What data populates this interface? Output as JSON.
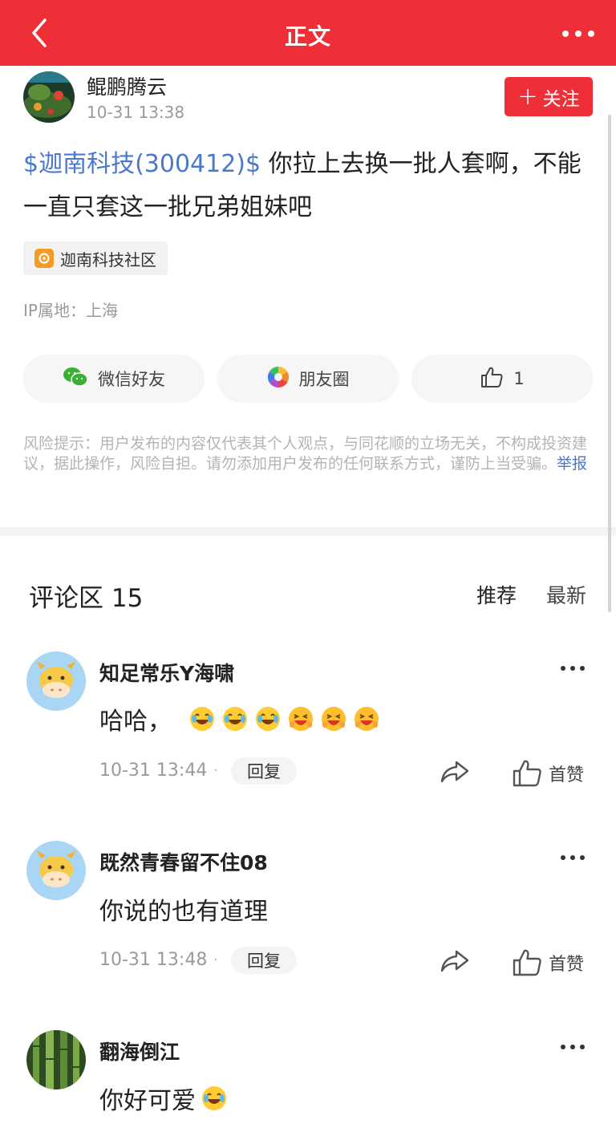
{
  "colors": {
    "accent": "#ee2f37",
    "link": "#4a78cf"
  },
  "topbar": {
    "title": "正文",
    "back_icon": "chevron-left-icon",
    "more_icon": "more-dots-icon"
  },
  "author": {
    "name": "鲲鹏腾云",
    "time": "10-31 13:38",
    "follow_label": "关注"
  },
  "post": {
    "stock_tag": "$迦南科技(300412)$",
    "text": " 你拉上去换一批人套啊，不能一直只套这一批兄弟姐妹吧",
    "community": "迦南科技社区",
    "ip_location": "IP属地：上海"
  },
  "share": {
    "wechat_label": "微信好友",
    "moments_label": "朋友圈",
    "like_count": "1"
  },
  "risk": {
    "text": "风险提示：用户发布的内容仅代表其个人观点，与同花顺的立场无关，不构成投资建议，据此操作，风险自担。请勿添加用户发布的任何联系方式，谨防上当受骗。",
    "report_label": "举报"
  },
  "comments_header": {
    "title": "评论区 15",
    "sort_recommend": "推荐",
    "sort_latest": "最新"
  },
  "comments": [
    {
      "name": "知足常乐Y海啸",
      "text": "哈哈，",
      "time": "10-31 13:44",
      "reply_label": "回复",
      "like_label": "首赞",
      "dot": "·"
    },
    {
      "name": "既然青春留不住08",
      "text": "你说的也有道理",
      "time": "10-31 13:48",
      "reply_label": "回复",
      "like_label": "首赞",
      "dot": "·"
    },
    {
      "name": "翻海倒江",
      "text": "你好可爱"
    }
  ]
}
